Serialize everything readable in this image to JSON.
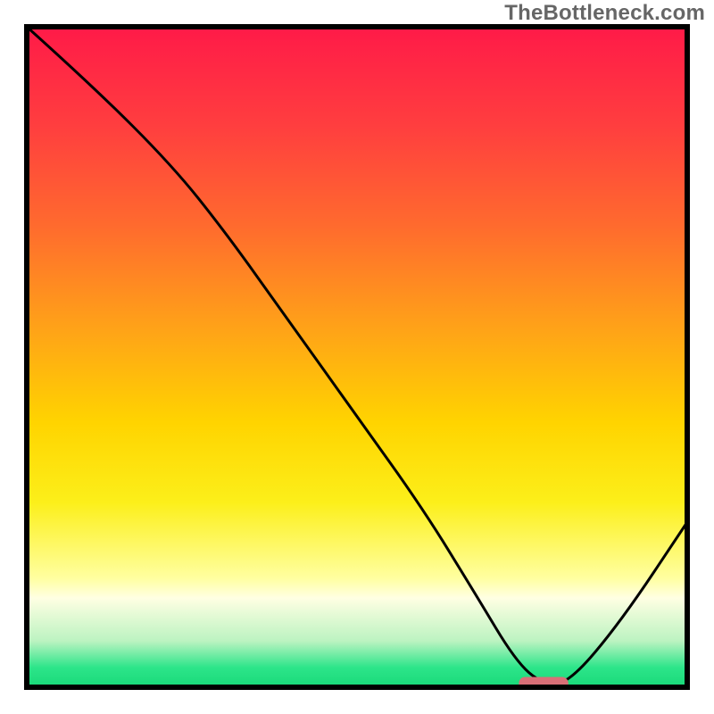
{
  "attribution": "TheBottleneck.com",
  "chart_data": {
    "type": "line",
    "title": "",
    "xlabel": "",
    "ylabel": "",
    "x_range": [
      0,
      100
    ],
    "y_range": [
      0,
      100
    ],
    "series": [
      {
        "name": "bottleneck-curve",
        "x": [
          0,
          10,
          22,
          30,
          40,
          50,
          60,
          68,
          74,
          78,
          82,
          90,
          100
        ],
        "y": [
          100,
          91,
          79,
          69,
          55,
          41,
          27,
          14,
          4,
          0.5,
          0.5,
          10,
          25
        ]
      }
    ],
    "optimal_marker": {
      "x_start": 74.5,
      "x_end": 82,
      "y": 0.6,
      "color": "#d96f77"
    },
    "gradient_bands": [
      {
        "offset": 0.0,
        "color": "#ff1a48"
      },
      {
        "offset": 0.15,
        "color": "#ff3e3f"
      },
      {
        "offset": 0.3,
        "color": "#ff6a2e"
      },
      {
        "offset": 0.45,
        "color": "#ffa019"
      },
      {
        "offset": 0.6,
        "color": "#ffd400"
      },
      {
        "offset": 0.72,
        "color": "#fcef1a"
      },
      {
        "offset": 0.835,
        "color": "#ffffa0"
      },
      {
        "offset": 0.865,
        "color": "#ffffe3"
      },
      {
        "offset": 0.93,
        "color": "#bcf3c1"
      },
      {
        "offset": 0.97,
        "color": "#2de58a"
      },
      {
        "offset": 1.0,
        "color": "#18d978"
      }
    ],
    "frame_color": "#000000",
    "line_color": "#000000",
    "line_width": 3
  }
}
